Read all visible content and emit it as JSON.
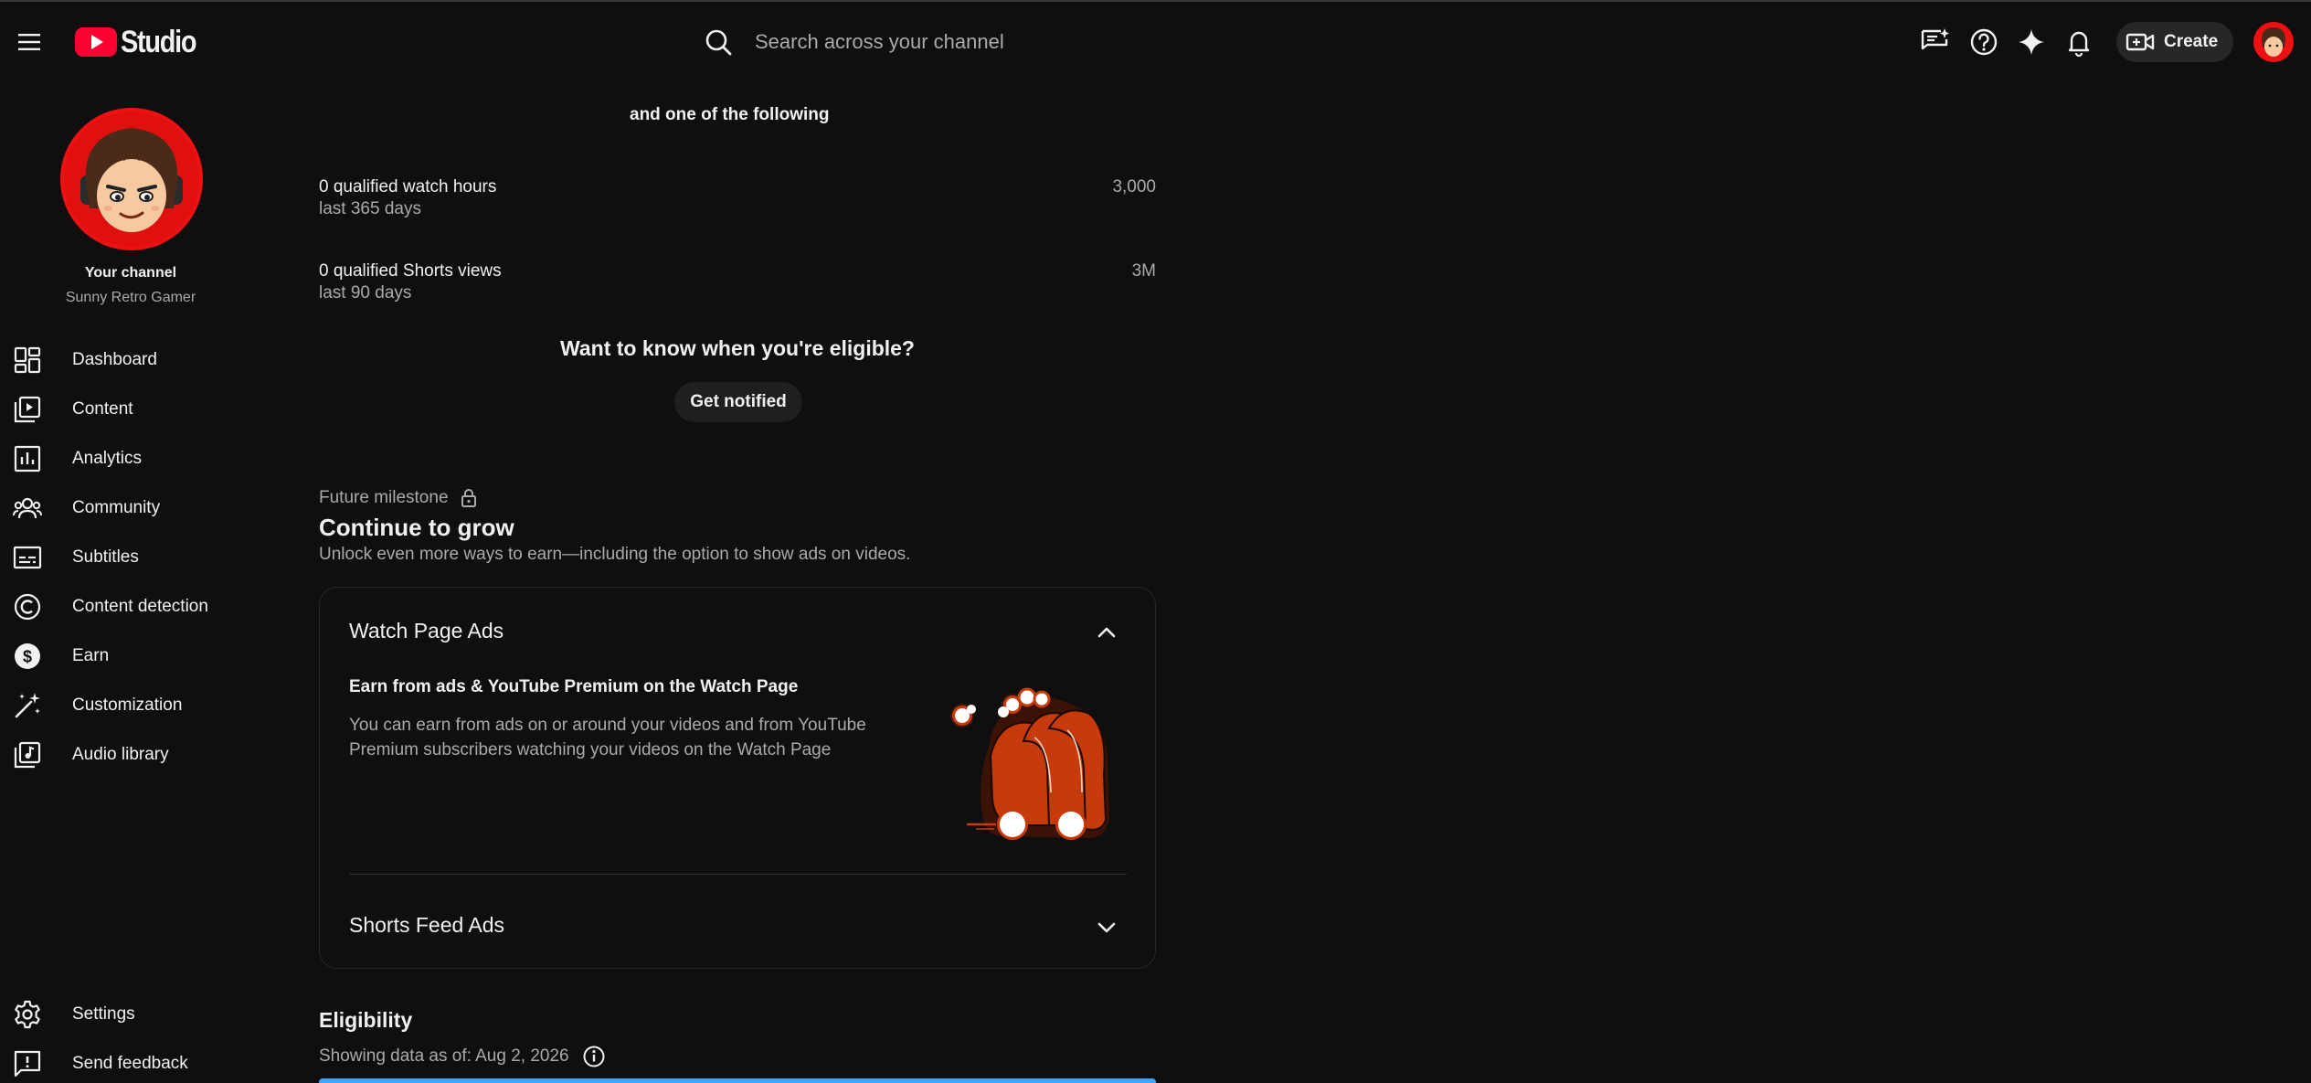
{
  "header": {
    "app_name": "Studio",
    "search_placeholder": "Search across your channel",
    "create_label": "Create"
  },
  "sidebar": {
    "channel_title": "Your channel",
    "channel_name": "Sunny Retro Gamer",
    "items": [
      {
        "label": "Dashboard",
        "icon": "dashboard-icon"
      },
      {
        "label": "Content",
        "icon": "content-icon"
      },
      {
        "label": "Analytics",
        "icon": "analytics-icon"
      },
      {
        "label": "Community",
        "icon": "community-icon"
      },
      {
        "label": "Subtitles",
        "icon": "subtitles-icon"
      },
      {
        "label": "Content detection",
        "icon": "copyright-icon"
      },
      {
        "label": "Earn",
        "icon": "dollar-icon"
      },
      {
        "label": "Customization",
        "icon": "magic-wand-icon"
      },
      {
        "label": "Audio library",
        "icon": "audio-library-icon"
      }
    ],
    "bottom_items": [
      {
        "label": "Settings",
        "icon": "gear-icon"
      },
      {
        "label": "Send feedback",
        "icon": "feedback-icon"
      }
    ]
  },
  "main": {
    "requirements_connector": "and one of the following",
    "requirements": [
      {
        "label": "0 qualified watch hours",
        "period": "last 365 days",
        "target": "3,000"
      },
      {
        "label": "0 qualified Shorts views",
        "period": "last 90 days",
        "target": "3M"
      }
    ],
    "eligible_prompt": "Want to know when you're eligible?",
    "get_notified_label": "Get notified",
    "future_milestone_label": "Future milestone",
    "milestone_title": "Continue to grow",
    "milestone_desc": "Unlock even more ways to earn—including the option to show ads on videos.",
    "watch_page_ads": {
      "title": "Watch Page Ads",
      "subtitle": "Earn from ads & YouTube Premium on the Watch Page",
      "desc_line1": "You can earn from ads on or around your videos and from YouTube",
      "desc_line2": "Premium subscribers watching your videos on the Watch Page"
    },
    "shorts_feed_ads": {
      "title": "Shorts Feed Ads"
    },
    "eligibility": {
      "title": "Eligibility",
      "data_as_of": "Showing data as of: Aug 2, 2026"
    }
  },
  "colors": {
    "background": "#0f0f0f",
    "brand_red": "#ff0033",
    "illustration_orange": "#c63a0b",
    "progress_blue": "#3ea6ff"
  }
}
